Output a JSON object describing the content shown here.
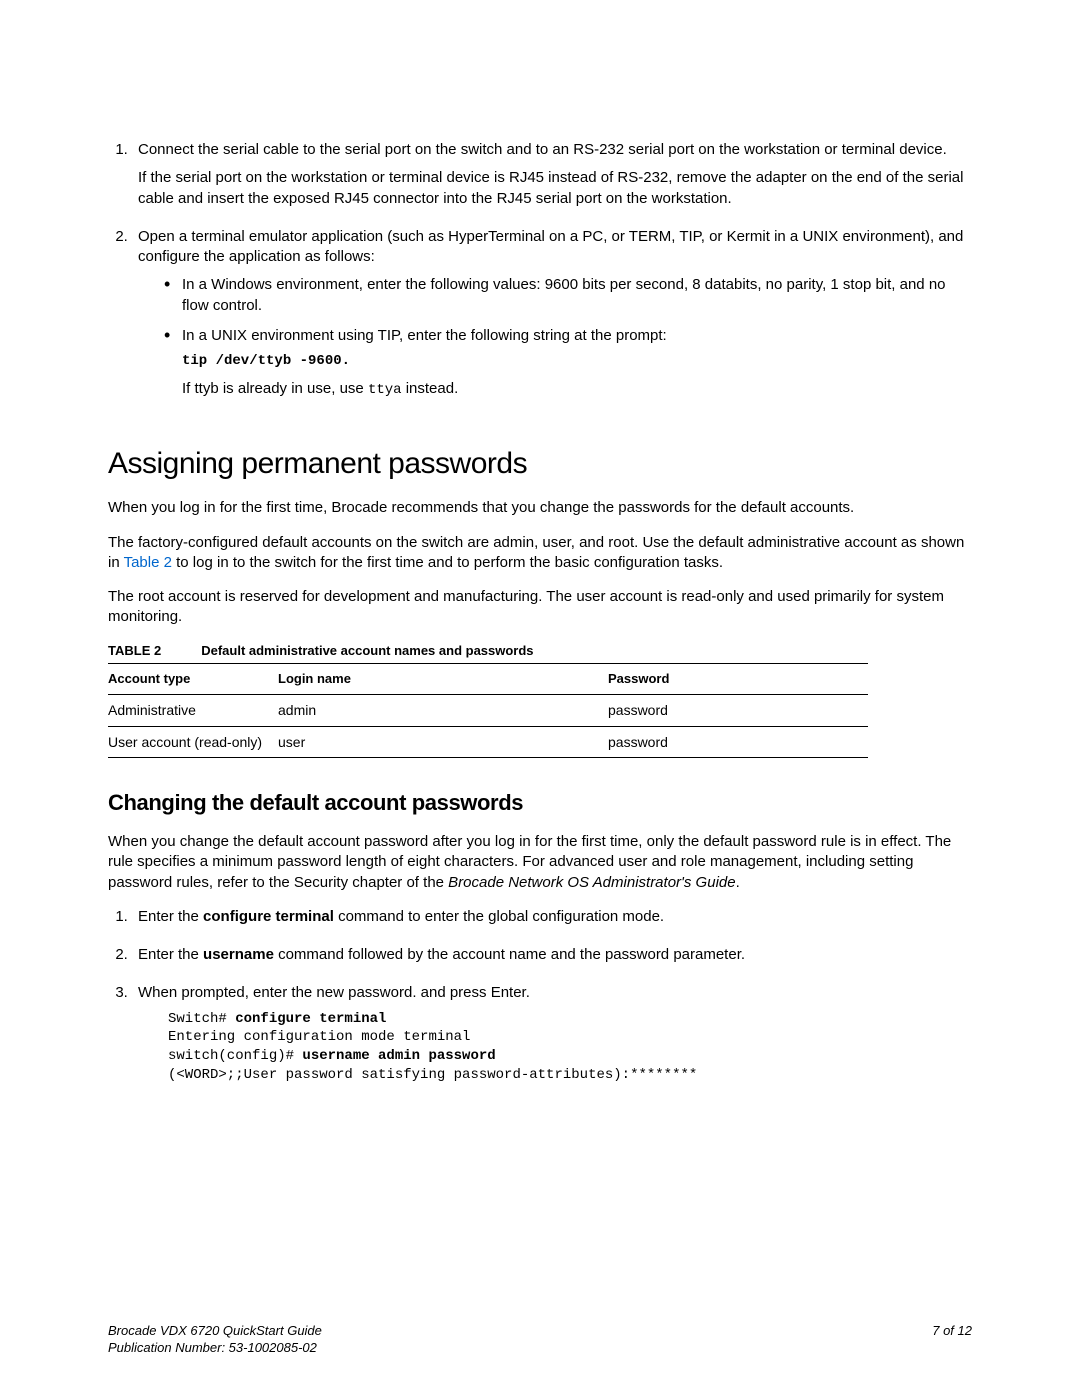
{
  "steps": {
    "s1p1": "Connect the serial cable to the serial port on the switch and to an RS-232 serial port on the workstation or terminal device.",
    "s1p2": "If the serial port on the workstation or terminal device is RJ45 instead of RS-232, remove the adapter on the end of the serial cable and insert the exposed RJ45 connector into the RJ45 serial port on the workstation.",
    "s2p1": "Open a terminal emulator application (such as HyperTerminal on a PC, or TERM, TIP, or Kermit in a UNIX environment), and configure the application as follows:",
    "s2b1": "In a Windows environment, enter the following values: 9600 bits per second, 8 databits, no parity, 1 stop bit, and no flow control.",
    "s2b2": "In a UNIX environment using TIP, enter the following string at the prompt:",
    "s2cmd": "tip /dev/ttyb -9600.",
    "s2note_a": "If ttyb is already in use, use ",
    "s2note_b": "ttya",
    "s2note_c": " instead."
  },
  "headings": {
    "h1": "Assigning permanent passwords",
    "h2": "Changing the default account passwords"
  },
  "para": {
    "p1": "When you log in for the first time, Brocade recommends that you change the passwords for the default accounts.",
    "p2a": "The factory-configured default accounts on the switch are admin, user, and root. Use the default administrative account as shown in ",
    "p2link": "Table 2",
    "p2b": " to log in to the switch for the first time and to perform the basic configuration tasks.",
    "p3": "The root account is reserved for development and manufacturing. The user account is read-only and used primarily for system monitoring.",
    "change1a": "When you change the default account password after you log in for the first time, only the default password rule is in effect. The rule specifies a minimum password length of eight characters. For advanced user and role management, including setting password rules, refer to the Security chapter of the ",
    "change1book": "Brocade Network OS Administrator's Guide",
    "change1b": "."
  },
  "table": {
    "caption_label": "TABLE 2",
    "caption_text": "Default administrative account names and passwords",
    "head": {
      "c1": "Account type",
      "c2": "Login name",
      "c3": "Password"
    },
    "rows": [
      {
        "c1": "Administrative",
        "c2": "admin",
        "c3": "password"
      },
      {
        "c1": "User account (read-only)",
        "c2": "user",
        "c3": "password"
      }
    ]
  },
  "changesteps": {
    "c1a": "Enter the ",
    "c1b": "configure terminal",
    "c1c": " command to enter the global configuration mode.",
    "c2a": "Enter the ",
    "c2b": "username",
    "c2c": " command followed by the account name and the password parameter.",
    "c3": "When prompted, enter the new password. and press Enter."
  },
  "terminal": {
    "l1a": "Switch# ",
    "l1b": "configure terminal",
    "l2": "Entering configuration mode terminal",
    "l3a": "switch(config)# ",
    "l3b": "username admin password",
    "l4": "(<WORD>;;User password satisfying password-attributes):********"
  },
  "footer": {
    "title": "Brocade VDX 6720 QuickStart Guide",
    "pub": "Publication Number: 53-1002085-02",
    "page": "7 of 12"
  }
}
